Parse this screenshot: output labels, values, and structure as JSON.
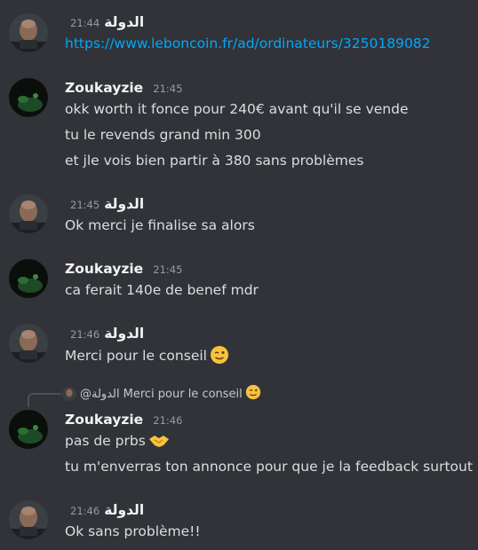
{
  "users": {
    "rock": {
      "name": "الدولة",
      "mention": "@الدولة",
      "avatar_icon": "bald-man-avatar-icon"
    },
    "zouk": {
      "name": "Zoukayzie",
      "avatar_icon": "dark-green-avatar-icon"
    }
  },
  "messages": [
    {
      "time": "21:44",
      "lines": [
        "https://www.leboncoin.fr/ad/ordinateurs/3250189082"
      ]
    },
    {
      "time": "21:45",
      "lines": [
        "okk worth it fonce pour 240€ avant qu'il se vende",
        "tu le revends grand min 300",
        "et jle vois bien partir à 380 sans problèmes"
      ]
    },
    {
      "time": "21:45",
      "lines": [
        "Ok merci je finalise sa alors"
      ]
    },
    {
      "time": "21:45",
      "lines": [
        "ca ferait 140e de benef mdr"
      ]
    },
    {
      "time": "21:46",
      "lines": [
        "Merci pour le conseil"
      ],
      "emoji": "winking-face-emoji"
    },
    {
      "time": "21:46",
      "lines": [
        "pas de prbs",
        "tu m'enverras ton annonce pour que je la feedback surtout !"
      ],
      "emoji": "handshake-emoji"
    },
    {
      "time": "21:46",
      "lines": [
        "Ok sans problème!!"
      ]
    }
  ],
  "reply": {
    "text": "Merci pour le conseil",
    "emoji": "winking-face-emoji"
  },
  "colors": {
    "background": "#313338",
    "link": "#00a8fc",
    "text": "#dbdee1",
    "timestamp": "#949ba4"
  }
}
